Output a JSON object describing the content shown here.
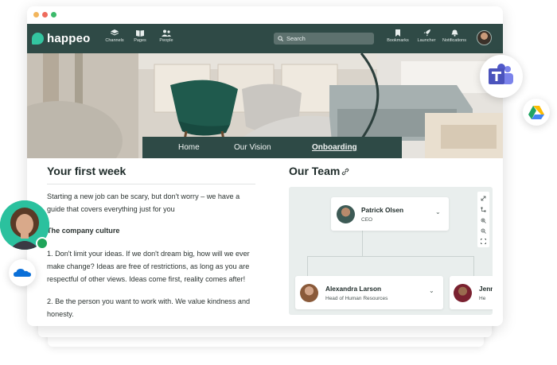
{
  "app": {
    "name": "happeo"
  },
  "nav": {
    "items": [
      {
        "label": "Channels",
        "icon": "layers-icon"
      },
      {
        "label": "Pages",
        "icon": "book-icon"
      },
      {
        "label": "People",
        "icon": "people-icon"
      }
    ],
    "search_placeholder": "Search",
    "right_items": [
      {
        "label": "Bookmarks",
        "icon": "bookmark-icon"
      },
      {
        "label": "Launcher",
        "icon": "rocket-icon"
      },
      {
        "label": "Notifications",
        "icon": "bell-icon"
      }
    ]
  },
  "hero": {
    "tabs": [
      {
        "label": "Home"
      },
      {
        "label": "Our Vision"
      },
      {
        "label": "Onboarding",
        "active": true
      }
    ]
  },
  "content": {
    "title": "Your first week",
    "intro": "Starting a new job can be scary, but don't worry – we have a guide that covers everything just for you",
    "section_title": "The company culture",
    "item1": "1. Don't limit your ideas. If we don't dream big, how will we ever make change? Ideas are free of restrictions, as long as you are respectful of other views. Ideas come first, reality comes after!",
    "item2": "2. Be the person you want to work with. We value kindness and honesty."
  },
  "team": {
    "title": "Our Team",
    "people": [
      {
        "name": "Patrick Olsen",
        "role": "CEO"
      },
      {
        "name": "Alexandra Larson",
        "role": "Head of Human Resources"
      },
      {
        "name": "Jenn",
        "role": "He"
      }
    ]
  },
  "colors": {
    "nav": "#2f4a46",
    "accent": "#33c5a0",
    "teams": "#5059c9",
    "onedrive": "#0a6fd8"
  }
}
